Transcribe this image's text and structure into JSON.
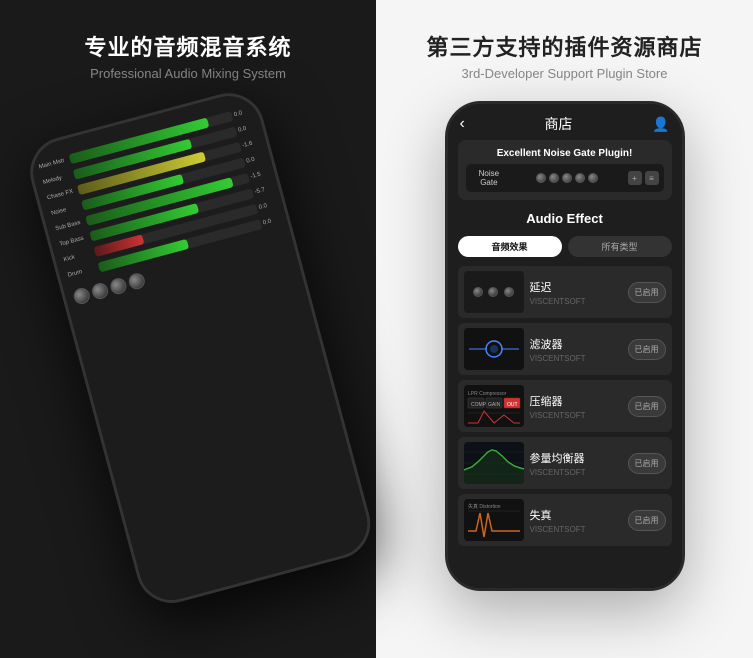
{
  "left": {
    "title_zh": "专业的音频混音系统",
    "title_en": "Professional Audio Mixing System",
    "channels": [
      {
        "label": "Main Mstr",
        "fill": 85,
        "type": "green",
        "value": "0.0"
      },
      {
        "label": "Melody",
        "fill": 70,
        "type": "green",
        "value": "0.0"
      },
      {
        "label": "Chase FX",
        "fill": 75,
        "type": "yellow",
        "value": "-1.6"
      },
      {
        "label": "Noise",
        "fill": 60,
        "type": "green",
        "value": "0.0"
      },
      {
        "label": "Sub Bass",
        "fill": 90,
        "type": "green",
        "value": "-1.5"
      },
      {
        "label": "Top Bass",
        "fill": 65,
        "type": "green",
        "value": "-5.7"
      },
      {
        "label": "Kick",
        "fill": 50,
        "type": "red",
        "value": "0.0"
      },
      {
        "label": "Drum",
        "fill": 55,
        "type": "green",
        "value": "0.0"
      }
    ]
  },
  "right": {
    "title_zh": "第三方支持的插件资源商店",
    "title_en": "3rd-Developer Support Plugin Store",
    "store": {
      "back_label": "‹",
      "title": "商店",
      "user_icon": "👤",
      "promo": {
        "title": "Excellent Noise Gate Plugin!",
        "plugin_name": "Noise Gate",
        "knob_count": 5
      },
      "section_title": "Audio Effect",
      "tabs": [
        {
          "label": "音频效果",
          "active": true
        },
        {
          "label": "所有类型",
          "active": false
        }
      ],
      "plugins": [
        {
          "name": "延迟",
          "developer": "VISCENTSOFT",
          "btn": "已启用",
          "type": "delay"
        },
        {
          "name": "滤波器",
          "developer": "VISCENTSOFT",
          "btn": "已启用",
          "type": "filter"
        },
        {
          "name": "压缩器",
          "developer": "VISCENTSOFT",
          "btn": "已启用",
          "type": "comp"
        },
        {
          "name": "参量均衡器",
          "developer": "VISCENTSOFT",
          "btn": "已启用",
          "type": "eq"
        },
        {
          "name": "失真",
          "developer": "VISCENTSOFT",
          "btn": "已启用",
          "type": "dist"
        }
      ]
    }
  }
}
